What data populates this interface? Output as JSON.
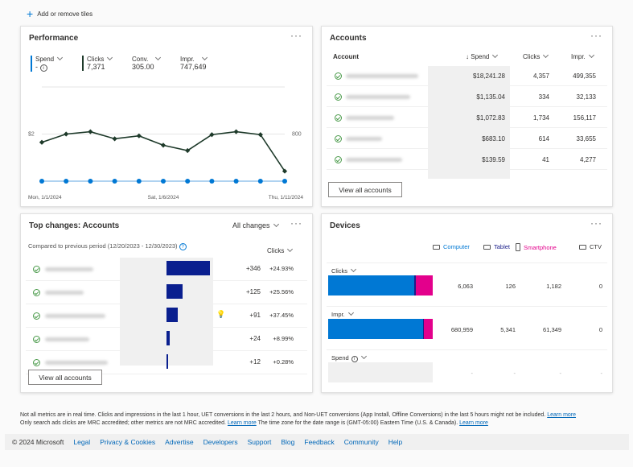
{
  "toolbar": {
    "add_tiles": "Add or remove tiles"
  },
  "performance": {
    "title": "Performance",
    "metrics": [
      {
        "label": "Spend",
        "value": "-"
      },
      {
        "label": "Clicks",
        "value": "7,371"
      },
      {
        "label": "Conv.",
        "value": "305.00"
      },
      {
        "label": "Impr.",
        "value": "747,649"
      }
    ],
    "colors": {
      "spend": "#0078d4",
      "clicks": "#1e3a2a"
    }
  },
  "chart_data": {
    "type": "line",
    "x": [
      "1/1/2024",
      "1/2/2024",
      "1/3/2024",
      "1/4/2024",
      "1/5/2024",
      "1/6/2024",
      "1/7/2024",
      "1/8/2024",
      "1/9/2024",
      "1/10/2024",
      "1/11/2024"
    ],
    "x_tick_labels": [
      "Mon, 1/1/2024",
      "Sat, 1/6/2024",
      "Thu, 1/11/2024"
    ],
    "left_tick_label": "$2",
    "right_tick_label": "800",
    "right_ylim": [
      0,
      1600
    ],
    "left_ylim": [
      0,
      4
    ],
    "grid": true,
    "series": [
      {
        "name": "Clicks",
        "axis": "right",
        "values": [
          660,
          800,
          840,
          720,
          770,
          610,
          520,
          790,
          840,
          790,
          170
        ]
      },
      {
        "name": "Spend",
        "axis": "left",
        "values": [
          0,
          0,
          0,
          0,
          0,
          0,
          0,
          0,
          0,
          0,
          0
        ]
      }
    ]
  },
  "accounts": {
    "title": "Accounts",
    "headers": [
      "Account",
      "Spend",
      "Clicks",
      "Impr."
    ],
    "rows": [
      {
        "spend": "$18,241.28",
        "clicks": "4,357",
        "impr": "499,355"
      },
      {
        "spend": "$1,135.04",
        "clicks": "334",
        "impr": "32,133"
      },
      {
        "spend": "$1,072.83",
        "clicks": "1,734",
        "impr": "156,117"
      },
      {
        "spend": "$683.10",
        "clicks": "614",
        "impr": "33,655"
      },
      {
        "spend": "$139.59",
        "clicks": "41",
        "impr": "4,277"
      }
    ],
    "view_all": "View all accounts"
  },
  "top_changes": {
    "title": "Top changes: Accounts",
    "filter": "All changes",
    "compare": "Compared to previous period (12/20/2023 - 12/30/2023)",
    "metric": "Clicks",
    "bar_color": "#0a1f8f",
    "rows": [
      {
        "change": 346,
        "change_label": "+346",
        "pct": "+24.93%"
      },
      {
        "change": 125,
        "change_label": "+125",
        "pct": "+25.56%"
      },
      {
        "change": 91,
        "change_label": "+91",
        "pct": "+37.45%",
        "insight": true
      },
      {
        "change": 24,
        "change_label": "+24",
        "pct": "+8.99%"
      },
      {
        "change": 12,
        "change_label": "+12",
        "pct": "+0.28%"
      }
    ],
    "view_all": "View all accounts"
  },
  "devices": {
    "title": "Devices",
    "legend": [
      {
        "label": "Computer",
        "color": "#0078d4"
      },
      {
        "label": "Tablet",
        "color": "#1b1f8a"
      },
      {
        "label": "Smartphone",
        "color": "#e3008c"
      },
      {
        "label": "CTV",
        "color": "#323130"
      }
    ],
    "rows": [
      {
        "label": "Clicks",
        "values": [
          "6,063",
          "126",
          "1,182",
          "0"
        ],
        "nums": [
          6063,
          126,
          1182,
          0
        ]
      },
      {
        "label": "Impr.",
        "values": [
          "680,959",
          "5,341",
          "61,349",
          "0"
        ],
        "nums": [
          680959,
          5341,
          61349,
          0
        ]
      },
      {
        "label": "Spend",
        "values": [
          "-",
          "-",
          "-",
          "-"
        ],
        "nums": [
          0,
          0,
          0,
          0
        ]
      }
    ]
  },
  "notes": {
    "line1": "Not all metrics are in real time. Clicks and impressions in the last 1 hour, UET conversions in the last 2 hours, and Non-UET conversions (App Install, Offline Conversions) in the last 5 hours might not be included.",
    "line2a": "Only search ads clicks are MRC accredited; other metrics are not MRC accredited.",
    "line2b": "The time zone for the date range is (GMT-05:00) Eastern Time (U.S. & Canada).",
    "learn_more": "Learn more"
  },
  "footer": {
    "copyright": "© 2024 Microsoft",
    "links": [
      "Legal",
      "Privacy & Cookies",
      "Advertise",
      "Developers",
      "Support",
      "Blog",
      "Feedback",
      "Community",
      "Help"
    ]
  }
}
